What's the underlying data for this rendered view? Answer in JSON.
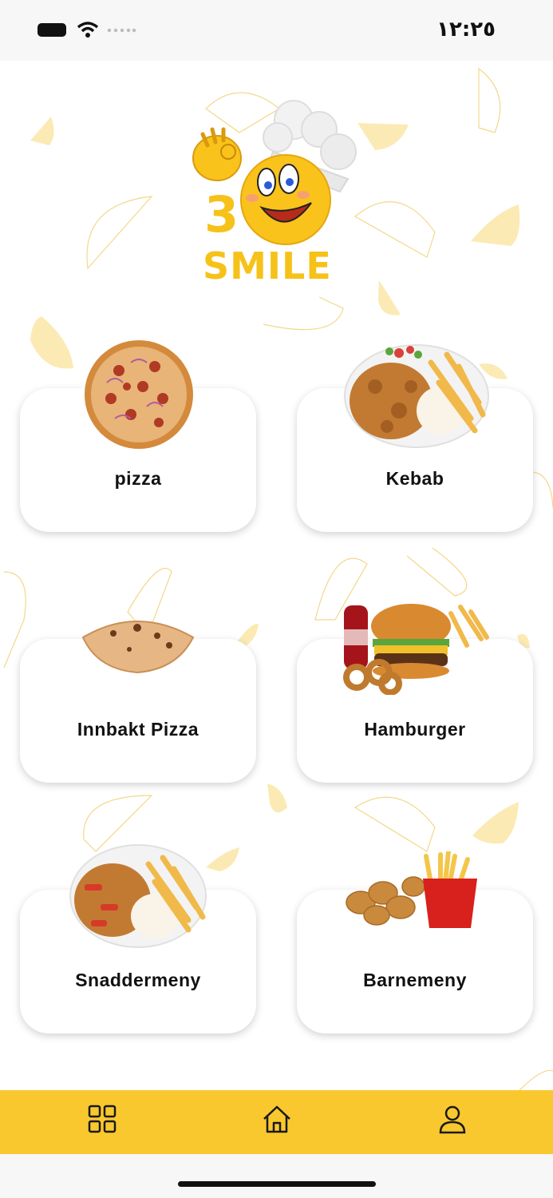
{
  "status": {
    "time": "١٢:٢٥"
  },
  "brand": {
    "number": "3",
    "name": "SMILE"
  },
  "categories": [
    {
      "label": "pizza"
    },
    {
      "label": "Kebab"
    },
    {
      "label": "Innbakt Pizza"
    },
    {
      "label": "Hamburger"
    },
    {
      "label": "Snaddermeny"
    },
    {
      "label": "Barnemeny"
    }
  ],
  "nav": {
    "items": [
      "grid-icon",
      "home-icon",
      "user-icon"
    ]
  },
  "colors": {
    "accent": "#f9c82e",
    "logo": "#f6c21a"
  }
}
